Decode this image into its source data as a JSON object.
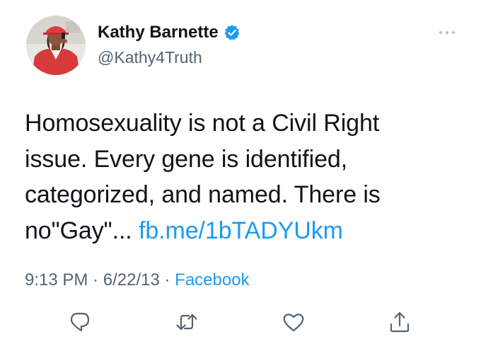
{
  "author": {
    "display_name": "Kathy Barnette",
    "handle": "@Kathy4Truth",
    "verified": true
  },
  "tweet": {
    "text_line1": "Homosexuality is not a Civil Right",
    "text_line2": "issue. Every gene is identified,",
    "text_line3": "categorized, and named. There is",
    "text_line4_prefix": "no\"Gay\"...",
    "link": "fb.me/1bTADYUkm"
  },
  "meta": {
    "time": "9:13 PM",
    "separator1": "·",
    "date": "6/22/13",
    "separator2": "·",
    "source": "Facebook"
  },
  "actions": [
    {
      "icon": "reply-icon"
    },
    {
      "icon": "retweet-icon"
    },
    {
      "icon": "like-icon"
    },
    {
      "icon": "share-icon"
    }
  ],
  "colors": {
    "text": "#0f1419",
    "secondary": "#536471",
    "link": "#1d9bf0",
    "verified": "#1d9bf0"
  }
}
